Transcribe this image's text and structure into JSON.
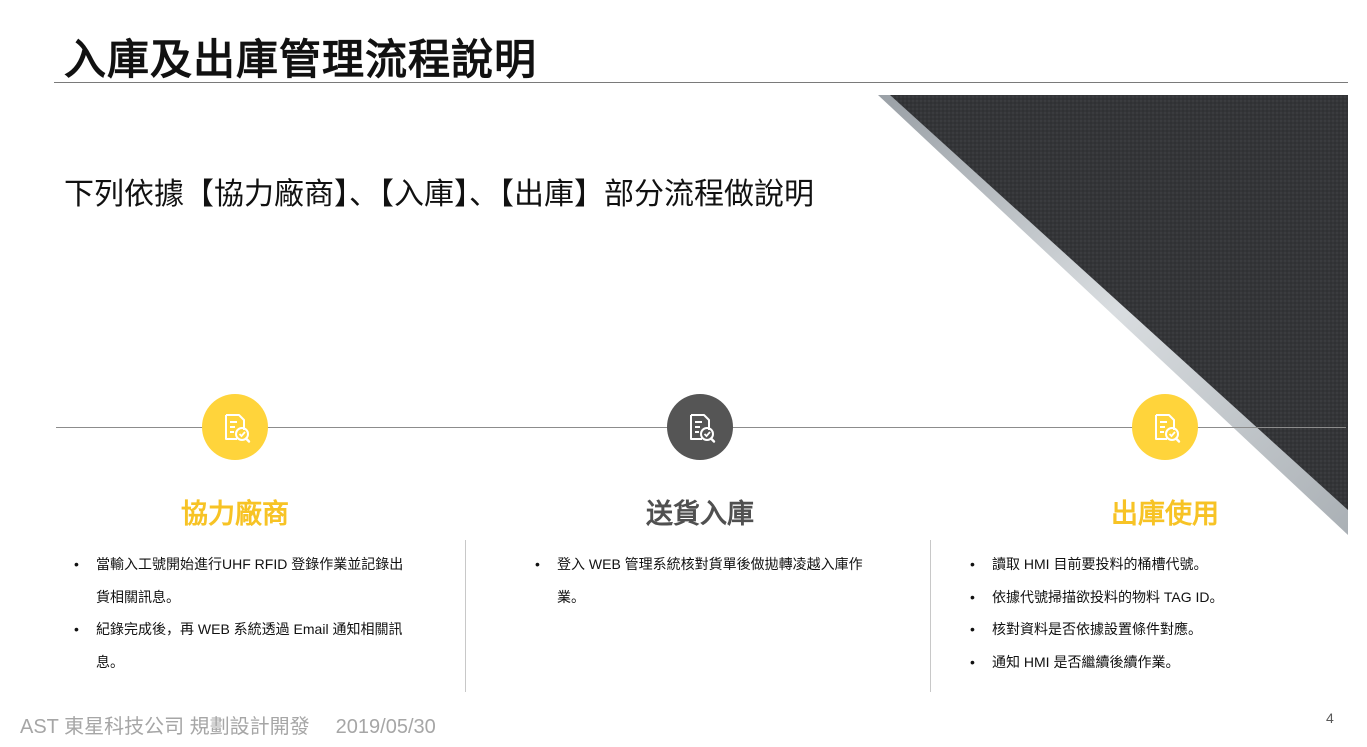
{
  "title": "入庫及出庫管理流程說明",
  "intro": "下列依據【協力廠商】、【入庫】、【出庫】部分流程做說明",
  "steps": [
    {
      "title": "協力廠商",
      "icon": "document-check-icon",
      "color": "#ffd43b",
      "bullets": [
        "當輸入工號開始進行UHF RFID 登錄作業並記錄出貨相關訊息。",
        "紀錄完成後，再 WEB 系統透過 Email 通知相關訊息。"
      ]
    },
    {
      "title": "送貨入庫",
      "icon": "document-check-icon",
      "color": "#555555",
      "bullets": [
        "登入 WEB 管理系統核對貨單後做拋轉凌越入庫作業。"
      ]
    },
    {
      "title": "出庫使用",
      "icon": "document-check-icon",
      "color": "#ffd43b",
      "bullets": [
        "讀取 HMI 目前要投料的桶槽代號。",
        "依據代號掃描欲投料的物料 TAG ID。",
        "核對資料是否依據設置條件對應。",
        "通知 HMI 是否繼續後續作業。"
      ]
    }
  ],
  "footer": {
    "company": "AST 東星科技公司 規劃設計開發",
    "date": "2019/05/30"
  },
  "page_number": "4",
  "colors": {
    "accent_yellow": "#ffd43b",
    "title_yellow": "#f7c325",
    "dark_gray": "#555555",
    "deco_dark": "#333538"
  }
}
